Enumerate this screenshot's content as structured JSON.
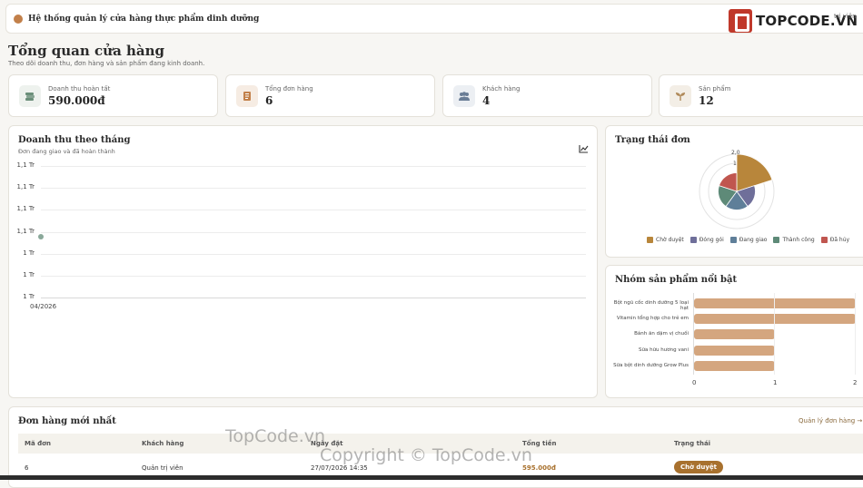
{
  "header": {
    "title": "Hệ thống quản lý cửa hàng thực phẩm dinh dưỡng",
    "user": "trị viên"
  },
  "brand": {
    "name": "TOPCODE.VN"
  },
  "page": {
    "title": "Tổng quan cửa hàng",
    "subtitle": "Theo dõi doanh thu, đơn hàng và sản phẩm đang kinh doanh."
  },
  "kpis": [
    {
      "label": "Doanh thu hoàn tất",
      "value": "590.000đ",
      "icon": "money-stack-icon",
      "color": "#6b8f7a",
      "bg": "#eef2ee"
    },
    {
      "label": "Tổng đơn hàng",
      "value": "6",
      "icon": "receipt-icon",
      "color": "#c2804a",
      "bg": "#f6ece3"
    },
    {
      "label": "Khách hàng",
      "value": "4",
      "icon": "users-icon",
      "color": "#6a7d96",
      "bg": "#eceff3"
    },
    {
      "label": "Sản phẩm",
      "value": "12",
      "icon": "sprout-icon",
      "color": "#b08a5a",
      "bg": "#f3eee6"
    }
  ],
  "revenue_card": {
    "title": "Doanh thu theo tháng",
    "subtitle": "Đơn đang giao và đã hoàn thành",
    "icon": "line-chart-icon"
  },
  "status_card": {
    "title": "Trạng thái đơn"
  },
  "top_products_card": {
    "title": "Nhóm sản phẩm nổi bật"
  },
  "orders_card": {
    "title": "Đơn hàng mới nhất",
    "link": "Quản lý đơn hàng →",
    "columns": [
      "Mã đơn",
      "Khách hàng",
      "Ngày đặt",
      "Tổng tiền",
      "Trạng thái"
    ],
    "rows": [
      {
        "id": "6",
        "customer": "Quản trị viên",
        "date": "27/07/2026 14:35",
        "total": "595.000đ",
        "status": "Chờ duyệt"
      }
    ]
  },
  "watermark": {
    "a": "TopCode.vn",
    "b": "Copyright © TopCode.vn"
  },
  "chart_data": [
    {
      "type": "line",
      "x": [
        "04/2026"
      ],
      "series": [
        {
          "values": [
            1100000
          ]
        }
      ],
      "ytick_labels": [
        "1,1 Tr",
        "1,1 Tr",
        "1,1 Tr",
        "1,1 Tr",
        "1 Tr",
        "1 Tr",
        "1 Tr"
      ],
      "color": "#8aa89a"
    },
    {
      "type": "pie",
      "variant": "polar-area",
      "labels": [
        "Chờ duyệt",
        "Đóng gói",
        "Đang giao",
        "Thành công",
        "Đã hủy"
      ],
      "values": [
        2,
        1,
        1,
        1,
        1
      ],
      "colors": [
        "#b8863b",
        "#6f6f9a",
        "#5f7f99",
        "#5e8a78",
        "#c0564f"
      ],
      "rtick_labels": [
        "2,0",
        "1"
      ],
      "legend": "bottom"
    },
    {
      "type": "bar",
      "orientation": "horizontal",
      "categories": [
        "Bột ngũ cốc dinh dưỡng 5 loại hạt",
        "Vitamin tổng hợp cho trẻ em",
        "Bánh ăn dặm vị chuối",
        "Sữa hữu hương vani",
        "Sữa bột dinh dưỡng Grow Plus"
      ],
      "values": [
        2,
        2,
        1,
        1,
        1
      ],
      "xlim": [
        0,
        2
      ],
      "xtick_labels": [
        "0",
        "1",
        "2"
      ],
      "color": "#d4a67f"
    }
  ]
}
